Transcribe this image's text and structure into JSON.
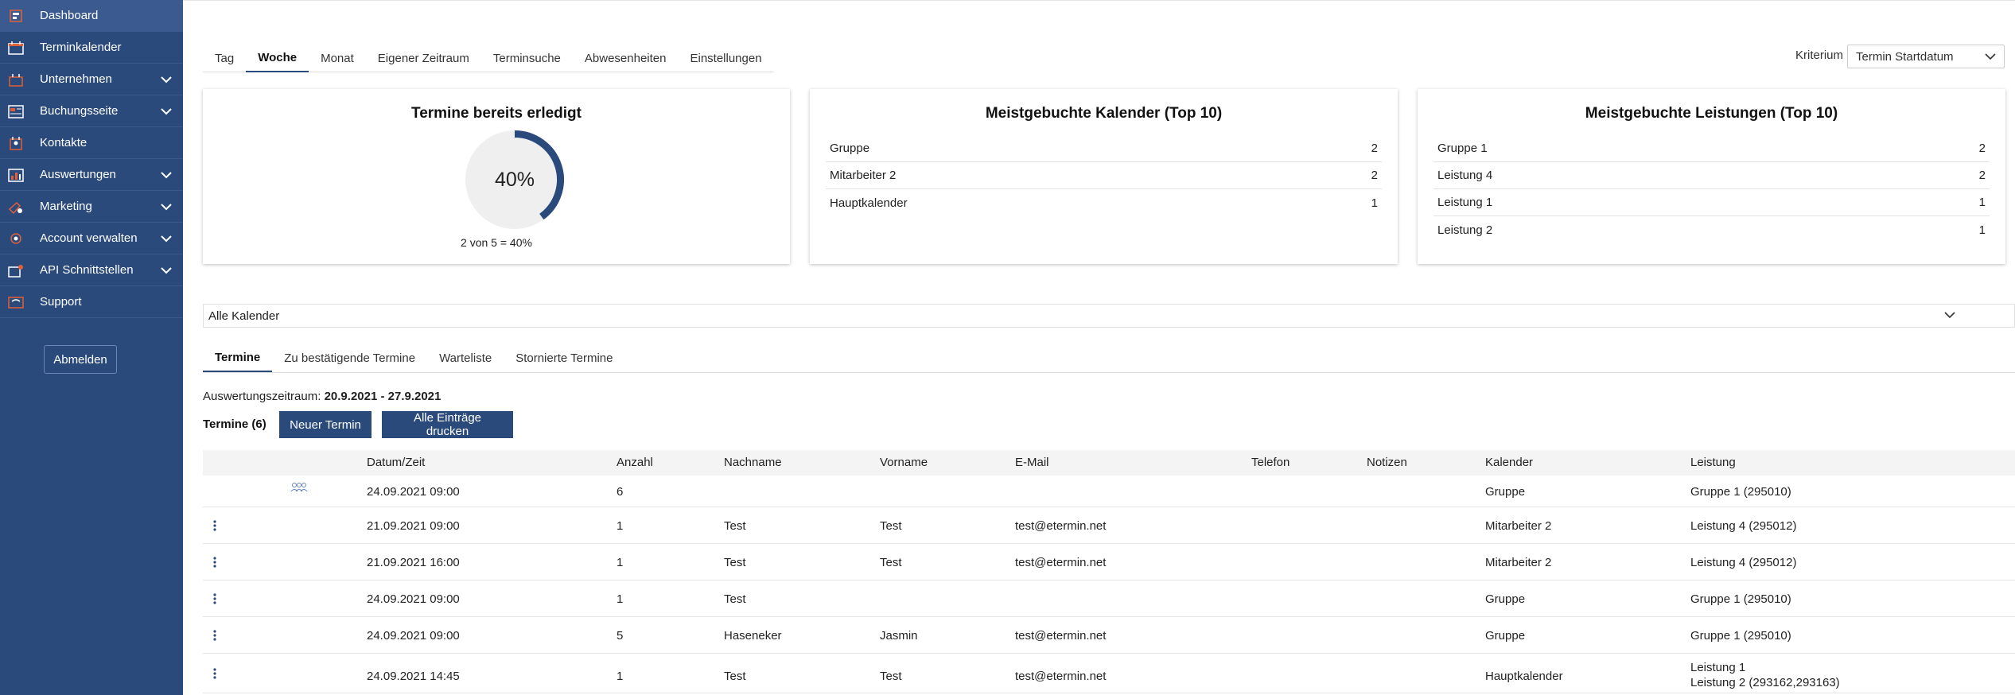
{
  "sidebar": {
    "items": [
      {
        "label": "Dashboard",
        "icon": "dashboard-icon"
      },
      {
        "label": "Terminkalender",
        "icon": "calendar-icon"
      },
      {
        "label": "Unternehmen",
        "icon": "company-icon",
        "expandable": true
      },
      {
        "label": "Buchungsseite",
        "icon": "booking-page-icon",
        "expandable": true
      },
      {
        "label": "Kontakte",
        "icon": "contacts-icon"
      },
      {
        "label": "Auswertungen",
        "icon": "reports-icon",
        "expandable": true
      },
      {
        "label": "Marketing",
        "icon": "marketing-icon",
        "expandable": true
      },
      {
        "label": "Account verwalten",
        "icon": "account-settings-icon",
        "expandable": true
      },
      {
        "label": "API Schnittstellen",
        "icon": "api-icon",
        "expandable": true
      },
      {
        "label": "Support",
        "icon": "support-icon"
      }
    ],
    "logout_label": "Abmelden"
  },
  "view_tabs": [
    "Tag",
    "Woche",
    "Monat",
    "Eigener Zeitraum",
    "Terminsuche",
    "Abwesenheiten",
    "Einstellungen"
  ],
  "active_view_tab": "Woche",
  "criterion": {
    "label": "Kriterium",
    "value": "Termin Startdatum"
  },
  "card_done": {
    "title": "Termine bereits erledigt",
    "percent_label": "40%",
    "percent": 0.4,
    "caption": "2 von 5 = 40%"
  },
  "card_calendars": {
    "title": "Meistgebuchte Kalender (Top 10)",
    "rows": [
      {
        "name": "Gruppe",
        "count": "2"
      },
      {
        "name": "Mitarbeiter 2",
        "count": "2"
      },
      {
        "name": "Hauptkalender",
        "count": "1"
      }
    ]
  },
  "card_services": {
    "title": "Meistgebuchte Leistungen (Top 10)",
    "rows": [
      {
        "name": "Gruppe 1",
        "count": "2"
      },
      {
        "name": "Leistung 4",
        "count": "2"
      },
      {
        "name": "Leistung 1",
        "count": "1"
      },
      {
        "name": "Leistung 2",
        "count": "1"
      }
    ]
  },
  "calendar_filter": "Alle Kalender",
  "appointment_tabs": [
    "Termine",
    "Zu bestätigende Termine",
    "Warteliste",
    "Stornierte Termine"
  ],
  "range": {
    "label": "Auswertungszeitraum:",
    "value": "20.9.2021 - 27.9.2021"
  },
  "count_label": "Termine (6)",
  "new_button": "Neuer Termin",
  "print_button": "Alle Einträge drucken",
  "table": {
    "headers": {
      "datetime": "Datum/Zeit",
      "count": "Anzahl",
      "lastname": "Nachname",
      "firstname": "Vorname",
      "email": "E-Mail",
      "phone": "Telefon",
      "notes": "Notizen",
      "calendar": "Kalender",
      "service": "Leistung"
    },
    "rows": [
      {
        "datetime": "24.09.2021 09:00",
        "count": "6",
        "lastname": "",
        "firstname": "",
        "email": "",
        "phone": "",
        "notes": "",
        "calendar": "Gruppe",
        "service": "Gruppe 1 (295010)",
        "service2": ""
      },
      {
        "datetime": "21.09.2021 09:00",
        "count": "1",
        "lastname": "Test",
        "firstname": "Test",
        "email": "test@etermin.net",
        "phone": "",
        "notes": "",
        "calendar": "Mitarbeiter 2",
        "service": "Leistung 4 (295012)",
        "service2": ""
      },
      {
        "datetime": "21.09.2021 16:00",
        "count": "1",
        "lastname": "Test",
        "firstname": "Test",
        "email": "test@etermin.net",
        "phone": "",
        "notes": "",
        "calendar": "Mitarbeiter 2",
        "service": "Leistung 4 (295012)",
        "service2": ""
      },
      {
        "datetime": "24.09.2021 09:00",
        "count": "1",
        "lastname": "Test",
        "firstname": "",
        "email": "",
        "phone": "",
        "notes": "",
        "calendar": "Gruppe",
        "service": "Gruppe 1 (295010)",
        "service2": ""
      },
      {
        "datetime": "24.09.2021 09:00",
        "count": "5",
        "lastname": "Haseneker",
        "firstname": "Jasmin",
        "email": "test@etermin.net",
        "phone": "",
        "notes": "",
        "calendar": "Gruppe",
        "service": "Gruppe 1 (295010)",
        "service2": ""
      },
      {
        "datetime": "24.09.2021 14:45",
        "count": "1",
        "lastname": "Test",
        "firstname": "Test",
        "email": "test@etermin.net",
        "phone": "",
        "notes": "",
        "calendar": "Hauptkalender",
        "service": "Leistung 1",
        "service2": "Leistung 2 (293162,293163)"
      }
    ]
  },
  "colors": {
    "sidebar": "#2a4a7c",
    "accent": "#2a4a7c",
    "donut_track": "#efefef",
    "icon_orange": "#e0603a"
  }
}
